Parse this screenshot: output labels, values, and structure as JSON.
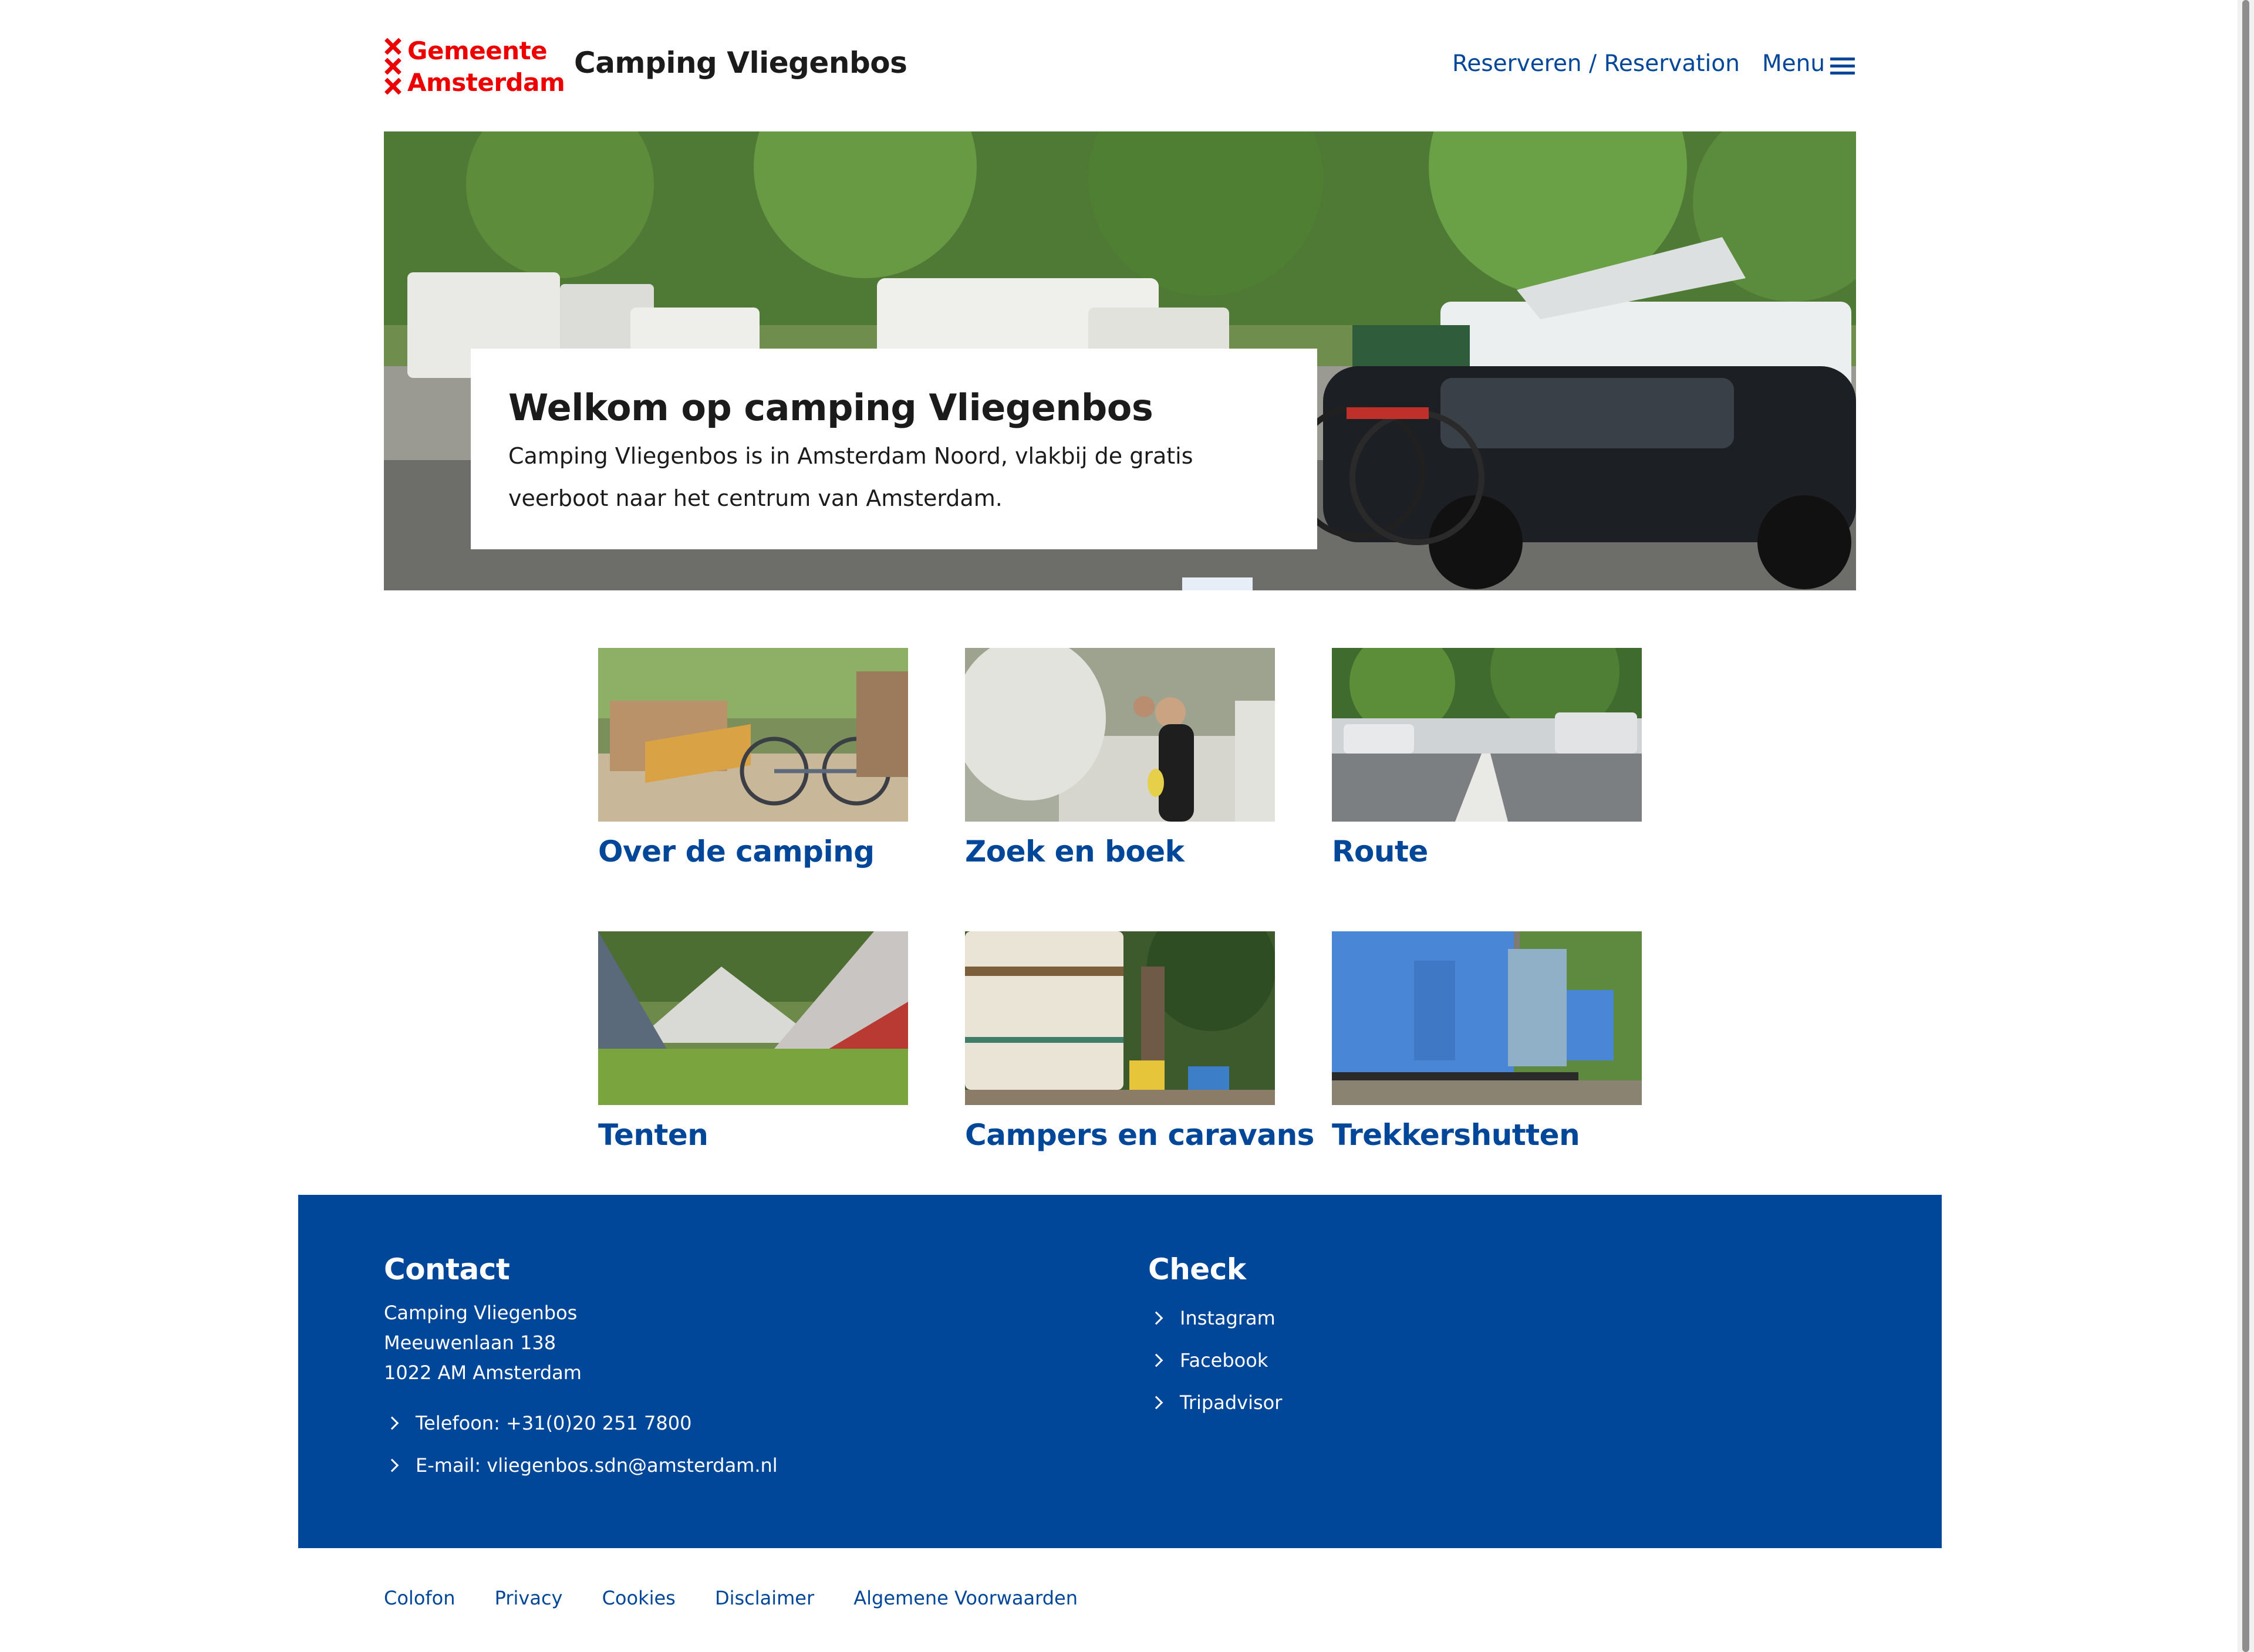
{
  "header": {
    "logo_line1": "Gemeente",
    "logo_line2": "Amsterdam",
    "site_title": "Camping Vliegenbos",
    "reserve_label": "Reserveren / Reservation",
    "menu_label": "Menu"
  },
  "hero": {
    "title": "Welkom op camping Vliegenbos",
    "text": "Camping Vliegenbos is in Amsterdam Noord, vlakbij de gratis veerboot naar het centrum van Amsterdam."
  },
  "tiles": [
    {
      "label": "Over de camping"
    },
    {
      "label": "Zoek en boek"
    },
    {
      "label": "Route"
    },
    {
      "label": "Tenten"
    },
    {
      "label": "Campers en caravans"
    },
    {
      "label": "Trekkershutten"
    }
  ],
  "footer": {
    "contact": {
      "heading": "Contact",
      "address": [
        "Camping Vliegenbos",
        "Meeuwenlaan 138",
        "1022 AM Amsterdam"
      ],
      "phone": "Telefoon: +31(0)20 251 7800",
      "email": "E-mail: vliegenbos.sdn@amsterdam.nl"
    },
    "check": {
      "heading": "Check",
      "links": [
        "Instagram",
        "Facebook",
        "Tripadvisor"
      ]
    }
  },
  "bottom_links": [
    "Colofon",
    "Privacy",
    "Cookies",
    "Disclaimer",
    "Algemene Voorwaarden"
  ],
  "colors": {
    "brand_blue": "#004699",
    "logo_red": "#ec0000",
    "text_dark": "#1b1b1b"
  },
  "icons": {
    "logo": "amsterdam-xxx-logo",
    "menu": "hamburger-icon",
    "link_arrow": "chevron-right-icon"
  }
}
